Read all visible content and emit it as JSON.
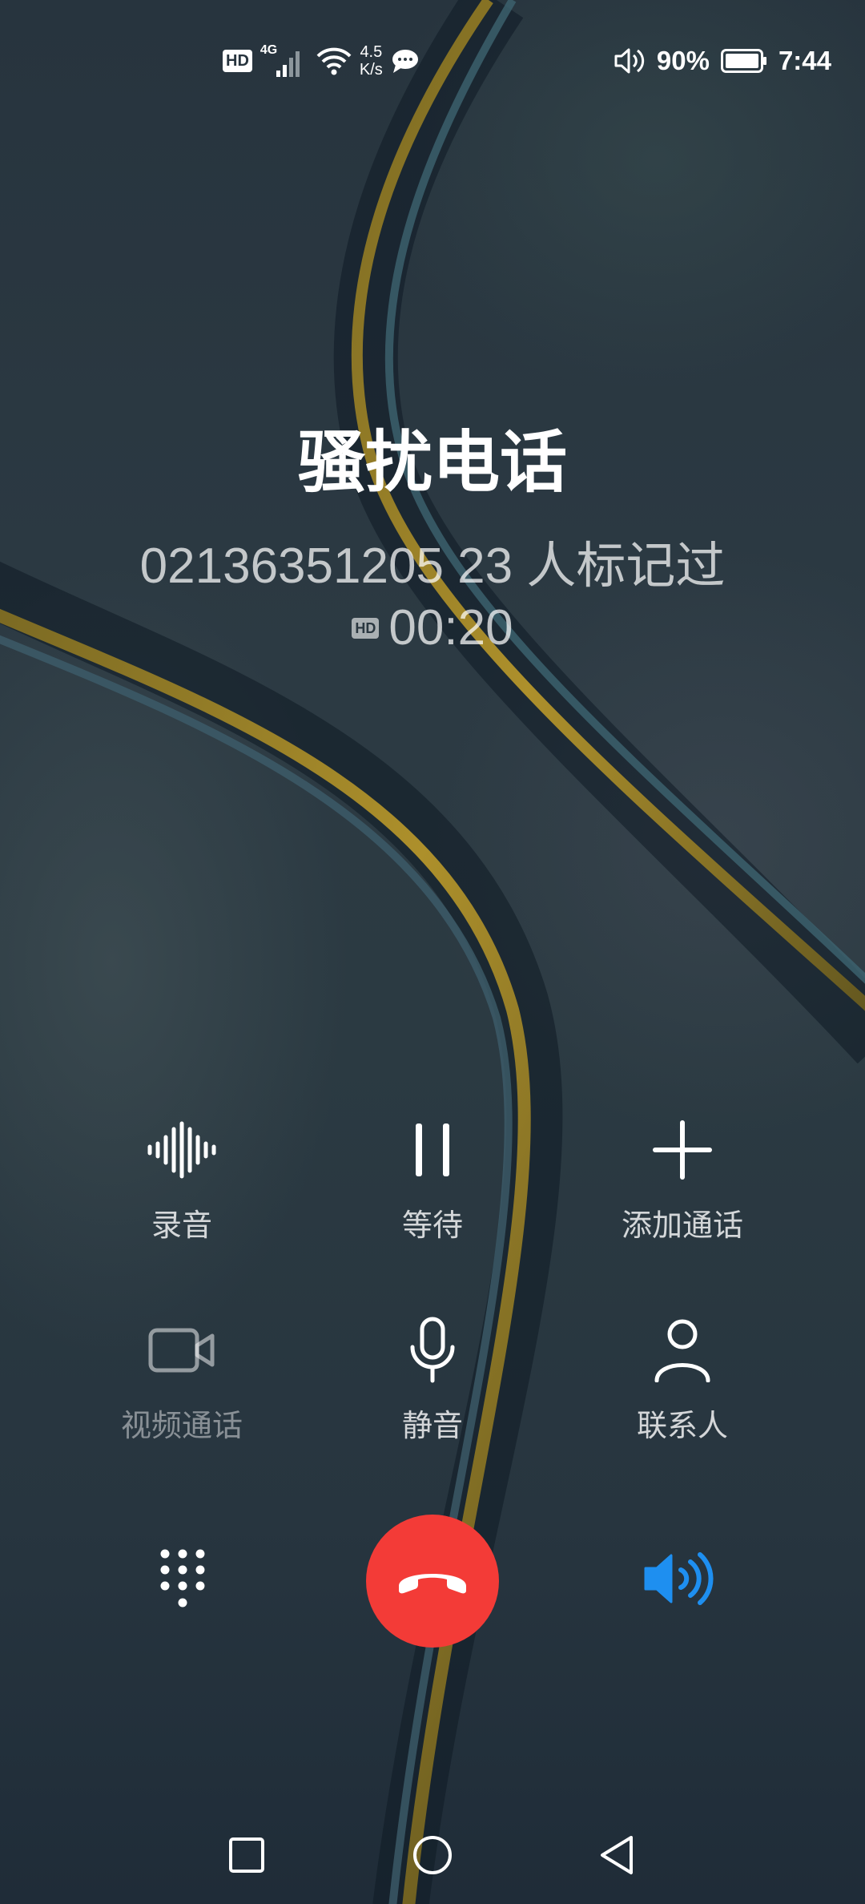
{
  "status_bar": {
    "hd_badge": "HD",
    "network_type": "4G",
    "net_speed_value": "4.5",
    "net_speed_unit": "K/s",
    "battery_percent": "90%",
    "time": "7:44",
    "icons": [
      "hd-icon",
      "signal-icon",
      "wifi-icon",
      "message-icon",
      "volume-icon",
      "battery-icon"
    ]
  },
  "call": {
    "caller_label": "骚扰电话",
    "number_and_tag": "02136351205 23 人标记过",
    "hd_badge": "HD",
    "duration": "00:20"
  },
  "controls": {
    "record": "录音",
    "hold": "等待",
    "add_call": "添加通话",
    "video_call": "视频通话",
    "mute": "静音",
    "contacts": "联系人"
  },
  "colors": {
    "end_call": "#f33b37",
    "speaker_active": "#1e8ff0"
  }
}
